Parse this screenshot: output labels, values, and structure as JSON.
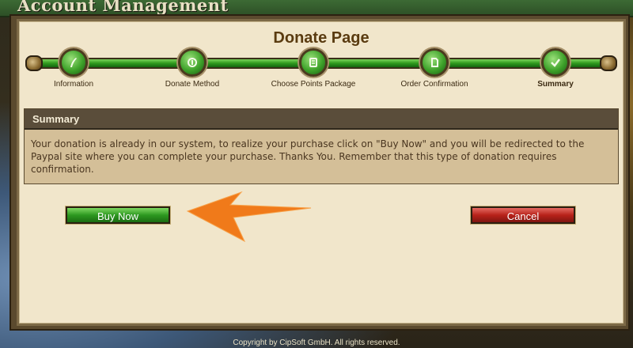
{
  "header": {
    "title": "Account Management"
  },
  "page": {
    "title": "Donate Page"
  },
  "steps": [
    {
      "label": "Information",
      "icon": "quill-icon"
    },
    {
      "label": "Donate Method",
      "icon": "coin-icon"
    },
    {
      "label": "Choose Points Package",
      "icon": "scroll-icon"
    },
    {
      "label": "Order Confirmation",
      "icon": "document-icon"
    },
    {
      "label": "Summary",
      "icon": "checkmark-icon"
    }
  ],
  "active_step": "Summary",
  "summary": {
    "heading": "Summary",
    "text": "Your donation is already in our system, to realize your purchase click on \"Buy Now\" and you will be redirected to the Paypal site where you can complete your purchase. Thanks You. Remember that this type of donation requires confirmation."
  },
  "buttons": {
    "buy_label": "Buy Now",
    "cancel_label": "Cancel"
  },
  "footer": {
    "text": "Copyright by CipSoft GmbH. All rights reserved."
  },
  "colors": {
    "accent_green": "#2d9820",
    "cancel_red": "#b8221a",
    "arrow_orange": "#f07a1a",
    "panel_bg": "#f1e6cb"
  }
}
